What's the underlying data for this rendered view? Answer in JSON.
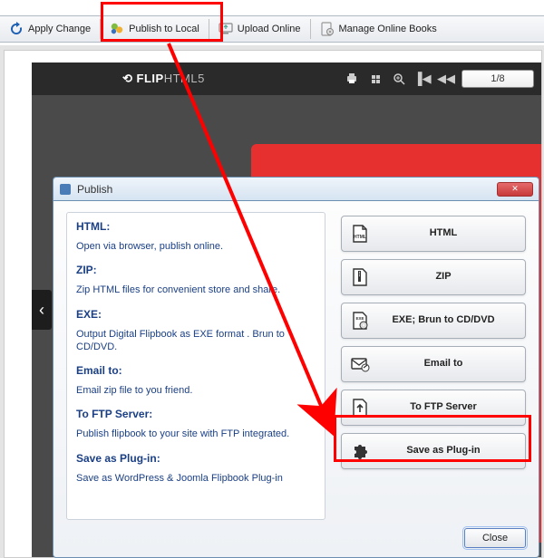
{
  "toolbar": {
    "apply_change": "Apply Change",
    "publish_local": "Publish to Local",
    "upload_online": "Upload Online",
    "manage_books": "Manage Online Books"
  },
  "viewer": {
    "logo_brand": "FLIP",
    "logo_product": "HTML5",
    "page_indicator": "1/8"
  },
  "dialog": {
    "title": "Publish",
    "close_label": "Close",
    "sections": [
      {
        "heading": "HTML:",
        "desc": "Open via browser, publish online."
      },
      {
        "heading": "ZIP:",
        "desc": "Zip HTML files for convenient store and share."
      },
      {
        "heading": "EXE:",
        "desc": "Output Digital Flipbook as EXE format . Brun to CD/DVD."
      },
      {
        "heading": "Email to:",
        "desc": "Email zip file to you friend."
      },
      {
        "heading": "To FTP Server:",
        "desc": "Publish flipbook to your site with FTP integrated."
      },
      {
        "heading": "Save as Plug-in:",
        "desc": "Save as WordPress & Joomla Flipbook Plug-in"
      }
    ],
    "options": {
      "html": "HTML",
      "zip": "ZIP",
      "exe": "EXE; Brun to CD/DVD",
      "email": "Email to",
      "ftp": "To FTP Server",
      "plugin": "Save as Plug-in"
    }
  }
}
